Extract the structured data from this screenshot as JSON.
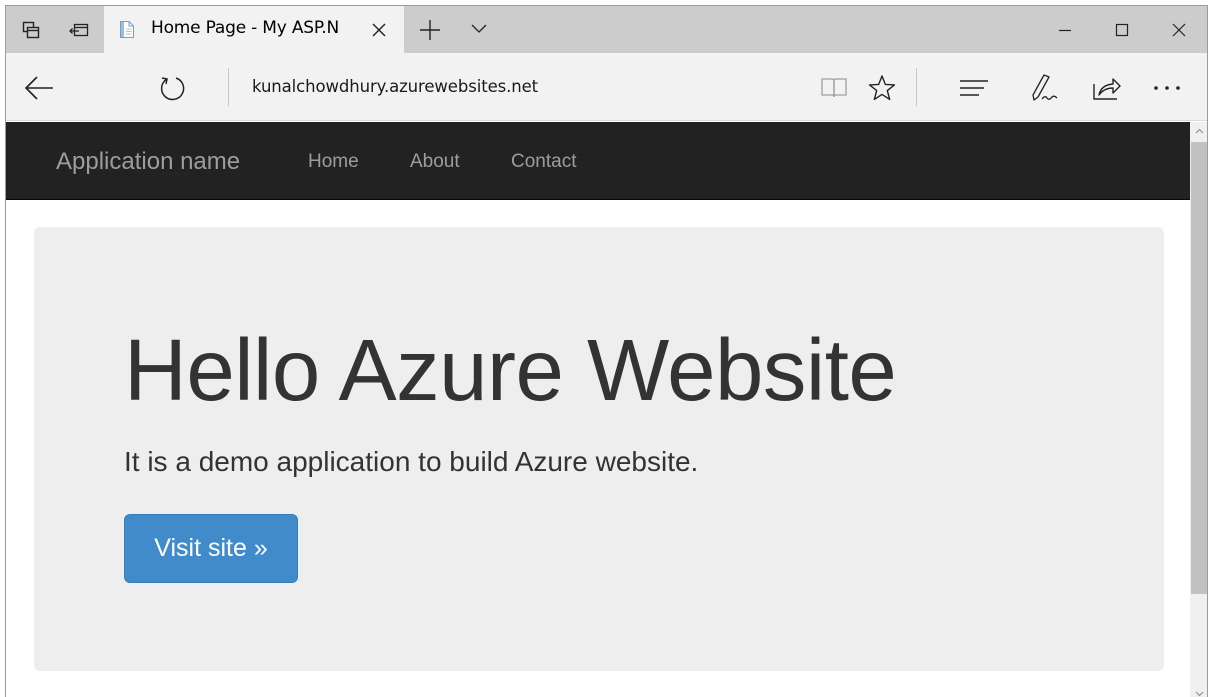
{
  "browser": {
    "tab": {
      "title": "Home Page - My ASP.N"
    },
    "address": {
      "url": "kunalchowdhury.azurewebsites.net"
    },
    "icons": {
      "tab_preview": "tab-preview-icon",
      "set_aside": "set-aside-tabs-icon",
      "favicon": "document-icon",
      "close_tab": "close-icon",
      "new_tab": "plus-icon",
      "tab_list": "chevron-down-icon",
      "minimize": "minimize-icon",
      "maximize": "maximize-icon",
      "close_window": "close-icon",
      "back": "back-arrow-icon",
      "refresh": "refresh-icon",
      "reading_view": "book-icon",
      "favorite": "star-icon",
      "hub": "hub-icon",
      "web_note": "pen-icon",
      "share": "share-icon",
      "more": "more-icon"
    }
  },
  "page": {
    "navbar": {
      "brand": "Application name",
      "links": [
        {
          "label": "Home"
        },
        {
          "label": "About"
        },
        {
          "label": "Contact"
        }
      ]
    },
    "jumbotron": {
      "heading": "Hello Azure Website",
      "lead": "It is a demo application to build Azure website.",
      "button_label": "Visit site »"
    }
  },
  "colors": {
    "navbar_bg": "#222222",
    "nav_text": "#9d9d9d",
    "jumbotron_bg": "#eeeeee",
    "primary_button": "#428bca",
    "tabstrip_bg": "#cccccc",
    "toolbar_bg": "#f2f2f2"
  }
}
